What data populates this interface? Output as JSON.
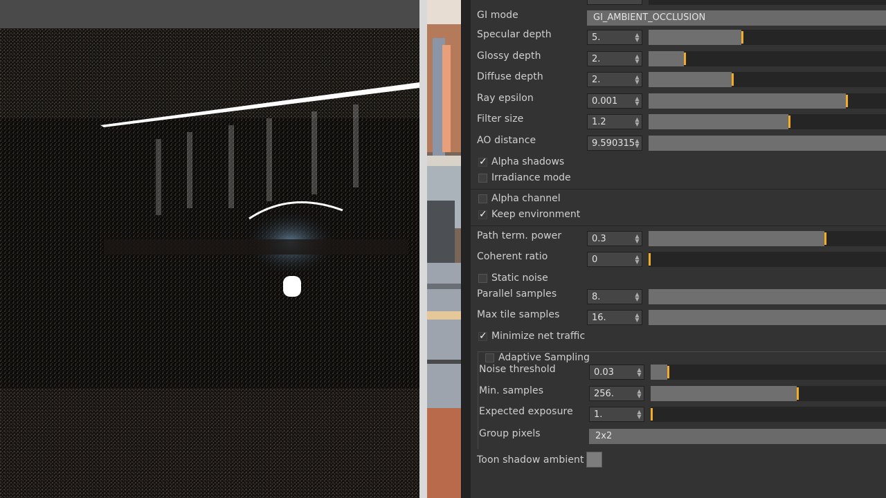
{
  "panel": {
    "gi_mode": {
      "label": "GI mode",
      "value": "GI_AMBIENT_OCCLUSION"
    },
    "params": [
      {
        "id": "specular",
        "label": "Specular depth",
        "value": "5.",
        "level": 0.39
      },
      {
        "id": "glossy",
        "label": "Glossy depth",
        "value": "2.",
        "level": 0.15
      },
      {
        "id": "diffuse",
        "label": "Diffuse depth",
        "value": "2.",
        "level": 0.35
      },
      {
        "id": "epsilon",
        "label": "Ray epsilon",
        "value": "0.001",
        "level": 0.83
      },
      {
        "id": "filter",
        "label": "Filter size",
        "value": "1.2",
        "level": 0.59
      },
      {
        "id": "ao",
        "label": "AO distance",
        "value": "9.590315",
        "level": 1.0
      }
    ],
    "checks1": [
      {
        "id": "alpha-shadows",
        "label": "Alpha shadows",
        "checked": true
      },
      {
        "id": "irradiance",
        "label": "Irradiance mode",
        "checked": false
      }
    ],
    "checks2": [
      {
        "id": "alpha-channel",
        "label": "Alpha channel",
        "checked": false
      },
      {
        "id": "keep-env",
        "label": "Keep environment",
        "checked": true
      }
    ],
    "params2": [
      {
        "id": "path-term",
        "label": "Path term. power",
        "value": "0.3",
        "level": 0.74
      },
      {
        "id": "coherent",
        "label": "Coherent ratio",
        "value": "0",
        "level": 0.0
      }
    ],
    "static_noise": {
      "label": "Static noise",
      "checked": false
    },
    "params3": [
      {
        "id": "parallel",
        "label": "Parallel samples",
        "value": "8.",
        "level": 1.0
      },
      {
        "id": "max-tile",
        "label": "Max tile samples",
        "value": "16.",
        "level": 1.0
      }
    ],
    "min_net": {
      "label": "Minimize net traffic",
      "checked": true
    },
    "adaptive": {
      "label": "Adaptive Sampling",
      "checked": false,
      "params": [
        {
          "id": "noise",
          "label": "Noise threshold",
          "value": "0.03",
          "level": 0.07
        },
        {
          "id": "min-samples",
          "label": "Min. samples",
          "value": "256.",
          "level": 0.62
        },
        {
          "id": "exposure",
          "label": "Expected exposure",
          "value": "1.",
          "level": 0.0
        }
      ],
      "group_pixels": {
        "label": "Group pixels",
        "value": "2x2"
      }
    },
    "toon": {
      "label": "Toon shadow ambient"
    }
  }
}
